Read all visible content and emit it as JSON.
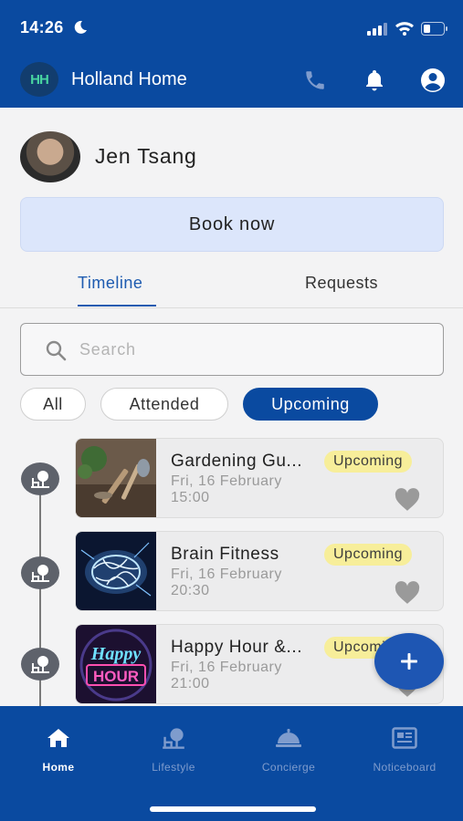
{
  "status_bar": {
    "time": "14:26"
  },
  "header": {
    "title": "Holland Home",
    "logo_text": "HH",
    "accent": "#0a4aa0"
  },
  "profile": {
    "name": "Jen Tsang"
  },
  "book_button": {
    "label": "Book now"
  },
  "tabs": [
    {
      "label": "Timeline",
      "active": true
    },
    {
      "label": "Requests",
      "active": false
    }
  ],
  "search": {
    "placeholder": "Search",
    "value": ""
  },
  "filters": [
    {
      "label": "All",
      "selected": false
    },
    {
      "label": "Attended",
      "selected": false
    },
    {
      "label": "Upcoming",
      "selected": true
    }
  ],
  "events": [
    {
      "title": "Gardening Gu...",
      "date": "Fri, 16 February",
      "time": "15:00",
      "badge": "Upcoming",
      "thumb_icon": "garden-tools-image"
    },
    {
      "title": "Brain Fitness",
      "date": "Fri, 16 February",
      "time": "20:30",
      "badge": "Upcoming",
      "thumb_icon": "brain-image"
    },
    {
      "title": "Happy Hour &...",
      "date": "Fri, 16 February",
      "time": "21:00",
      "badge": "Upcoming",
      "thumb_icon": "happy-hour-neon-image",
      "thumb_text": "Happy HOUR"
    }
  ],
  "fab": {
    "icon": "plus-icon"
  },
  "bottom_nav": [
    {
      "label": "Home",
      "icon": "home-icon",
      "active": true
    },
    {
      "label": "Lifestyle",
      "icon": "lifestyle-icon",
      "active": false
    },
    {
      "label": "Concierge",
      "icon": "concierge-bell-icon",
      "active": false
    },
    {
      "label": "Noticeboard",
      "icon": "noticeboard-icon",
      "active": false
    }
  ],
  "colors": {
    "primary": "#0a4aa0",
    "badge_bg": "#f7ee9a",
    "book_bg": "#dce6fb",
    "tab_active": "#1e5bb0"
  }
}
